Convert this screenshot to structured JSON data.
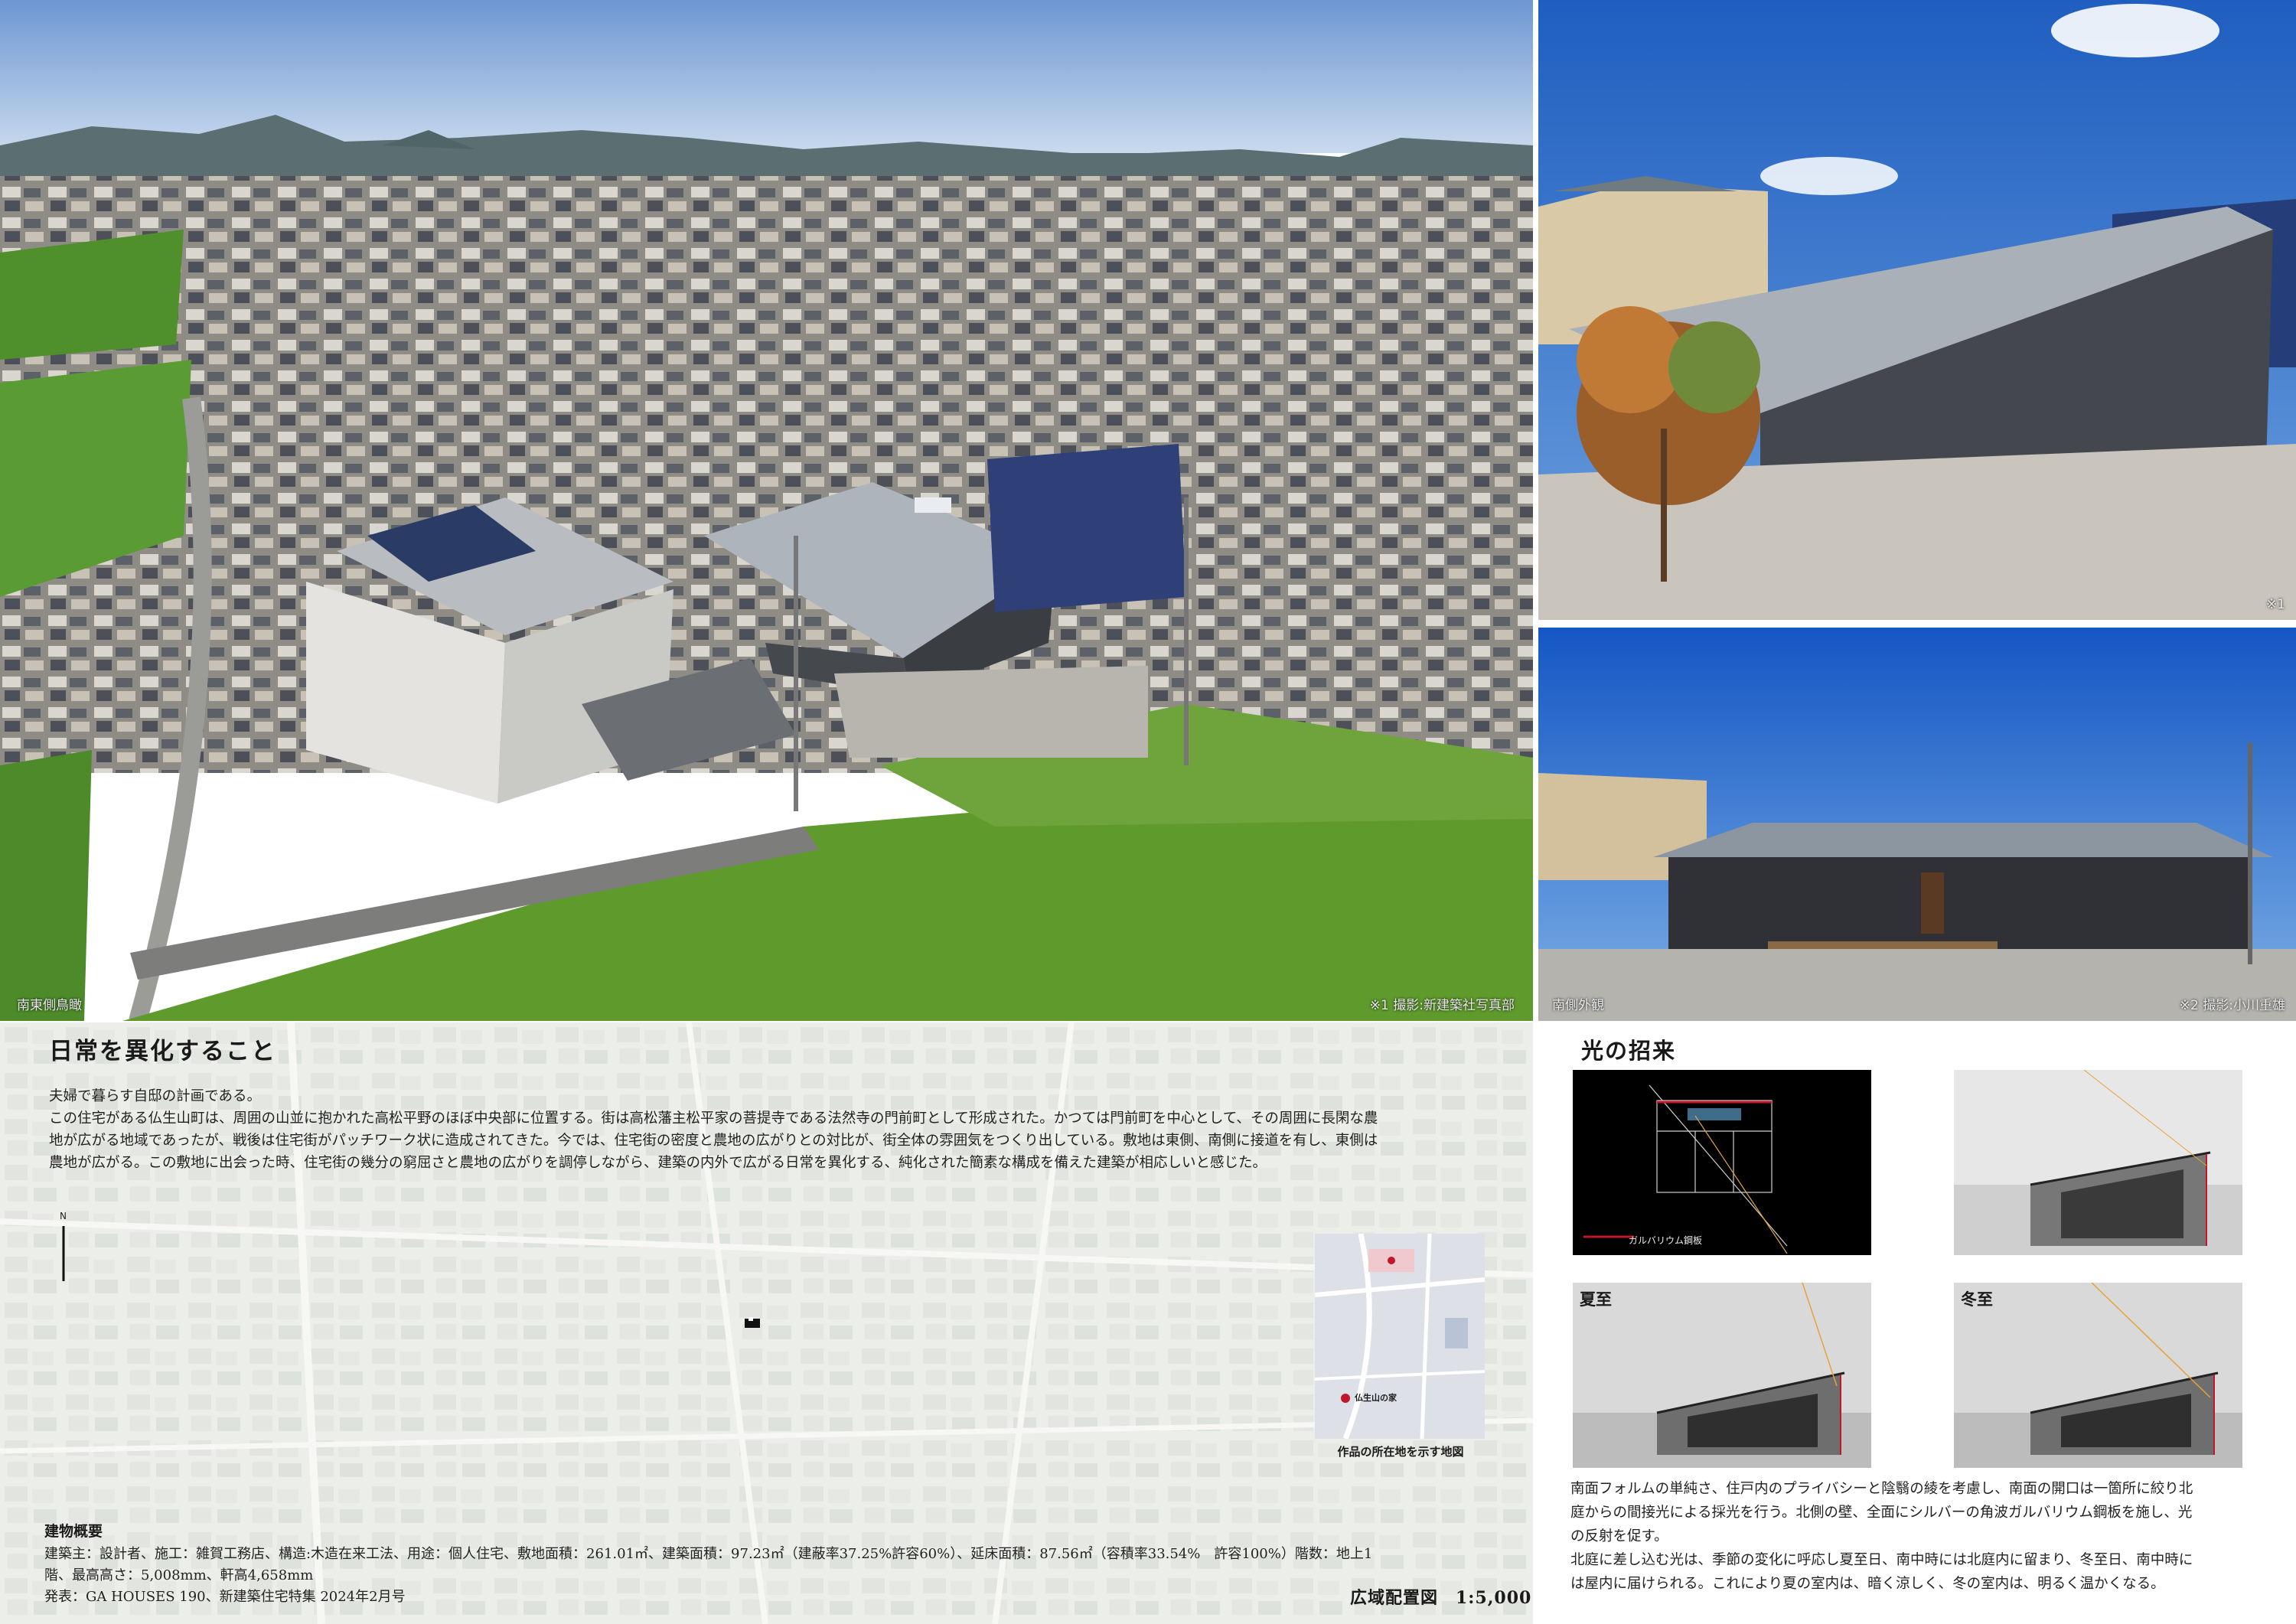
{
  "photos": {
    "aerial_caption": "南東側鳥瞰",
    "aerial_credit": "※1 撮影:新建築社写真部",
    "exterior_top_credit": "※1",
    "exterior_south_caption": "南側外観",
    "exterior_south_credit": "※2 撮影:小川重雄"
  },
  "main": {
    "title": "日常を異化すること",
    "intro": [
      "夫婦で暮らす自邸の計画である。",
      "この住宅がある仏生山町は、周囲の山並に抱かれた高松平野のほぼ中央部に位置する。街は高松藩主松平家の菩提寺である法然寺の門前町として形成された。かつては門前町を中心として、その周囲に長閑な農",
      "地が広がる地域であったが、戦後は住宅街がパッチワーク状に造成されてきた。今では、住宅街の密度と農地の広がりとの対比が、街全体の雰囲気をつくり出している。敷地は東側、南側に接道を有し、東側は",
      "農地が広がる。この敷地に出会った時、住宅街の幾分の窮屈さと農地の広がりを調停しながら、建築の内外で広がる日常を異化する、純化された簡素な構成を備えた建築が相応しいと感じた。"
    ]
  },
  "map": {
    "north": "N",
    "location_map_caption": "作品の所在地を示す地図",
    "location_map_labels": [
      "仏生山の家"
    ],
    "scale_label": "広域配置図　1:5,000"
  },
  "outline": {
    "title": "建物概要",
    "lines": [
      "建築主：設計者、施工：雑賀工務店、構造:木造在来工法、用途：個人住宅、敷地面積：261.01㎡、建築面積：97.23㎡（建蔽率37.25%許容60%）、延床面積：87.56㎡（容積率33.54%　許容100%）階数：地上1",
      "階、最高高さ：5,008mm、軒高4,658mm",
      "発表：GA HOUSES 190、新建築住宅特集 2024年2月号"
    ]
  },
  "light": {
    "title": "光の招来",
    "plan_legend": "ガルバリウム鋼板",
    "summer": "夏至",
    "winter": "冬至",
    "text": [
      "南面フォルムの単純さ、住戸内のプライバシーと陰翳の綾を考慮し、南面の開口は一箇所に絞り北",
      "庭からの間接光による採光を行う。北側の壁、全面にシルバーの角波ガルバリウム鋼板を施し、光",
      "の反射を促す。",
      "北庭に差し込む光は、季節の変化に呼応し夏至日、南中時には北庭内に留まり、冬至日、南中時に",
      "は屋内に届けられる。これにより夏の室内は、暗く涼しく、冬の室内は、明るく温かくなる。"
    ]
  },
  "colors": {
    "sky": "#6f9fd8",
    "roof": "#9aa3ab",
    "wall": "#3a3d42",
    "paddy": "#5f9a2c",
    "accent_red": "#c0182a",
    "sun_ray": "#e5a23a"
  }
}
